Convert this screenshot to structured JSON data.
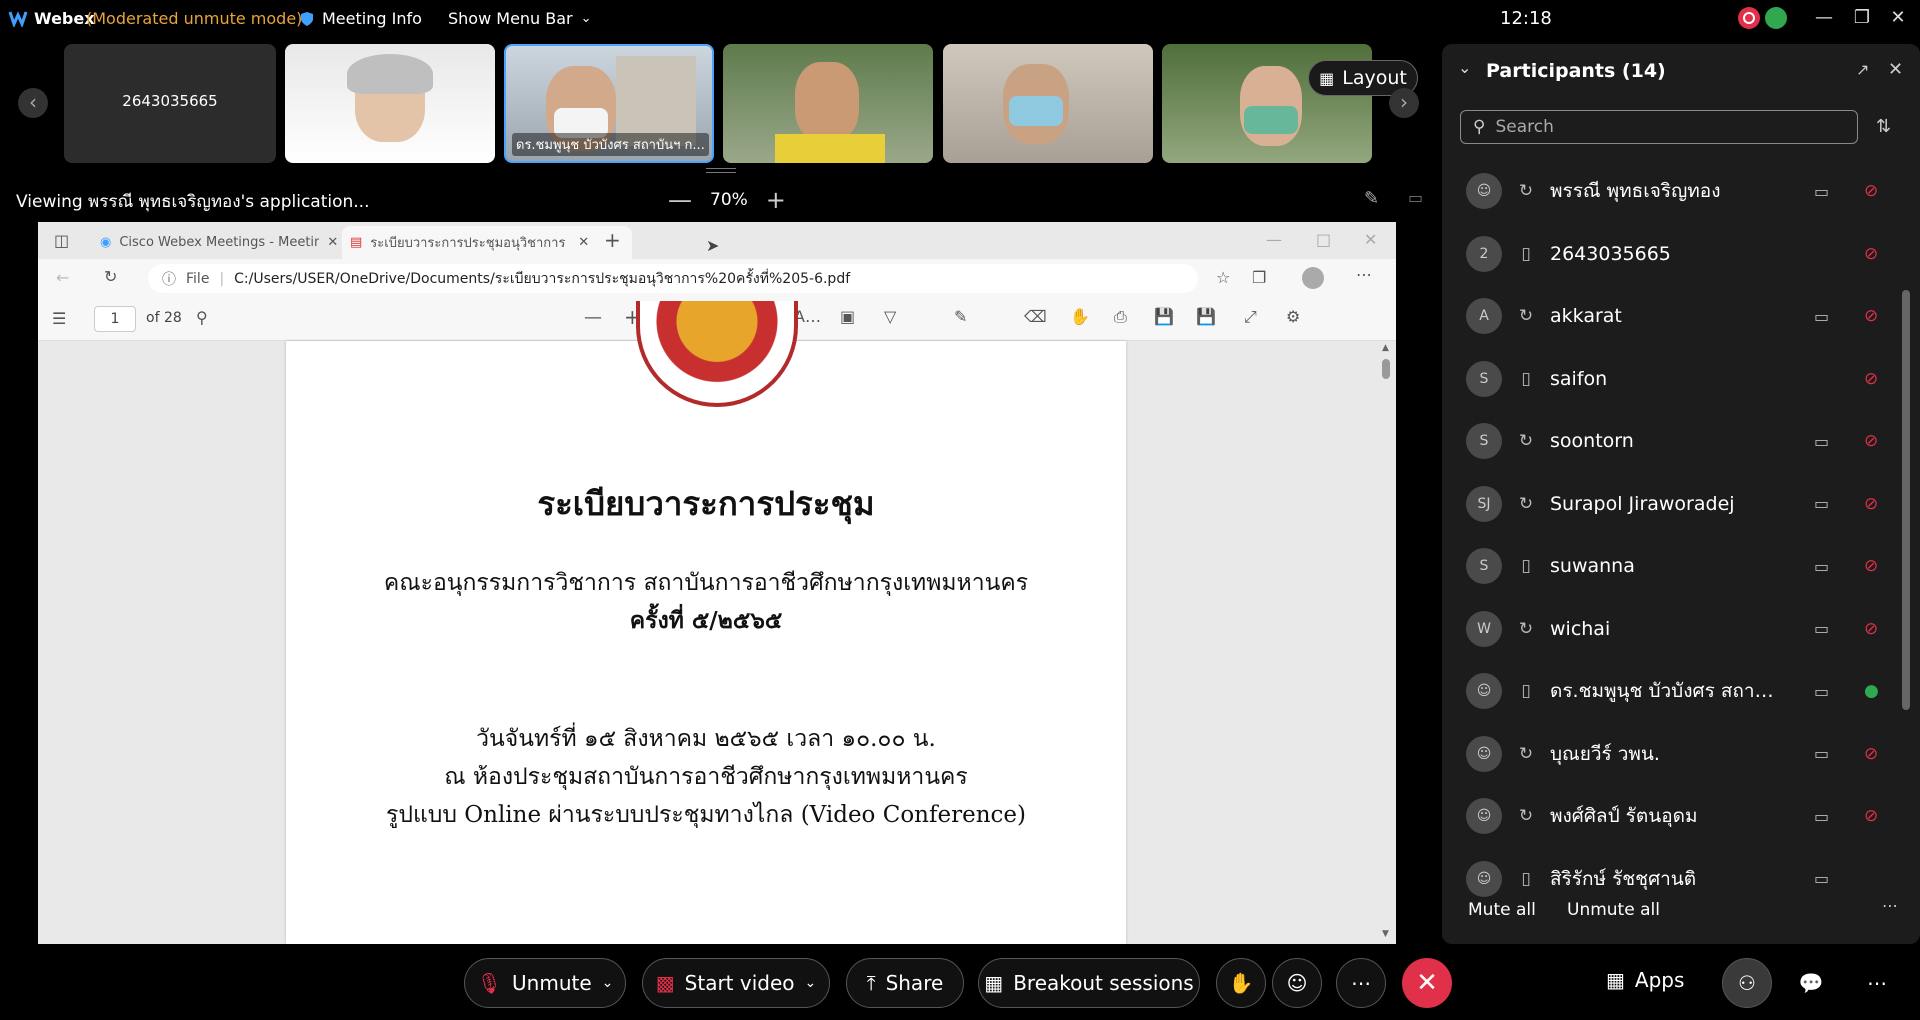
{
  "topbar": {
    "app_name": "Webex",
    "mode": "(Moderated unmute mode)",
    "meeting_info": "Meeting Info",
    "menu_bar": "Show Menu Bar",
    "clock": "12:18",
    "accent": "#e8a33a"
  },
  "filmstrip": {
    "tiles": [
      {
        "label": "2643035665"
      },
      {
        "label": ""
      },
      {
        "label": "ดร.ชมพูนุช บัวบังศร สถาบันฯ ก..."
      },
      {
        "label": ""
      },
      {
        "label": ""
      },
      {
        "label": ""
      }
    ],
    "layout_label": "Layout"
  },
  "share": {
    "viewing": "Viewing พรรณี พุทธเจริญทอง's application...",
    "zoom": "70%"
  },
  "browser": {
    "tabs": [
      {
        "label": "Cisco Webex Meetings - Meeting"
      },
      {
        "label": "ระเบียบวาระการประชุมอนุวิชาการ ครั้ง"
      }
    ],
    "url_prefix": "File",
    "url": "C:/Users/USER/OneDrive/Documents/ระเบียบวาระการประชุมอนุวิชาการ%20ครั้งที่%205-6.pdf",
    "page_number": "1",
    "page_total": "of 28"
  },
  "document": {
    "title": "ระเบียบวาระการประชุม",
    "committee": "คณะอนุกรรมการวิชาการ สถาบันการอาชีวศึกษากรุงเทพมหานคร",
    "session": "ครั้งที่  ๕/๒๕๖๕",
    "date": "วันจันทร์ที่  ๑๕ สิงหาคม ๒๕๖๕  เวลา ๑๐.๐๐ น.",
    "venue": "ณ ห้องประชุมสถาบันการอาชีวศึกษากรุงเทพมหานคร",
    "format": "รูปแบบ Online ผ่านระบบประชุมทางไกล (Video Conference)"
  },
  "participants": {
    "title": "Participants (14)",
    "search_placeholder": "Search",
    "list": [
      {
        "initials": "",
        "name": "พรรณี พุทธเจริญทอง",
        "device": "sync",
        "cam": true,
        "mic_on": false
      },
      {
        "initials": "2",
        "name": "2643035665",
        "device": "phone",
        "cam": false,
        "mic_on": false
      },
      {
        "initials": "A",
        "name": "akkarat",
        "device": "sync",
        "cam": true,
        "mic_on": false
      },
      {
        "initials": "S",
        "name": "saifon",
        "device": "phone",
        "cam": false,
        "mic_on": false
      },
      {
        "initials": "S",
        "name": "soontorn",
        "device": "sync",
        "cam": true,
        "mic_on": false
      },
      {
        "initials": "SJ",
        "name": "Surapol Jiraworadej",
        "device": "sync",
        "cam": true,
        "mic_on": false
      },
      {
        "initials": "S",
        "name": "suwanna",
        "device": "phone",
        "cam": true,
        "mic_on": false
      },
      {
        "initials": "W",
        "name": "wichai",
        "device": "sync",
        "cam": true,
        "mic_on": false
      },
      {
        "initials": "",
        "name": "ดร.ชมพูนุช บัวบังศร สถาบั...",
        "device": "phone",
        "cam": true,
        "mic_on": true
      },
      {
        "initials": "",
        "name": "บุณยวีร์ วพน.",
        "device": "sync",
        "cam": true,
        "mic_on": false
      },
      {
        "initials": "",
        "name": "พงศ์ศิลป์ รัตนอุดม",
        "device": "sync",
        "cam": true,
        "mic_on": false
      },
      {
        "initials": "",
        "name": "สิริรักษ์ รัชชุศานติ",
        "device": "phone",
        "cam": true,
        "mic_on": null
      }
    ],
    "mute_all": "Mute all",
    "unmute_all": "Unmute all"
  },
  "controls": {
    "unmute": "Unmute",
    "start_video": "Start video",
    "share": "Share",
    "breakout": "Breakout sessions",
    "apps": "Apps",
    "leave_color": "#e0304a"
  }
}
